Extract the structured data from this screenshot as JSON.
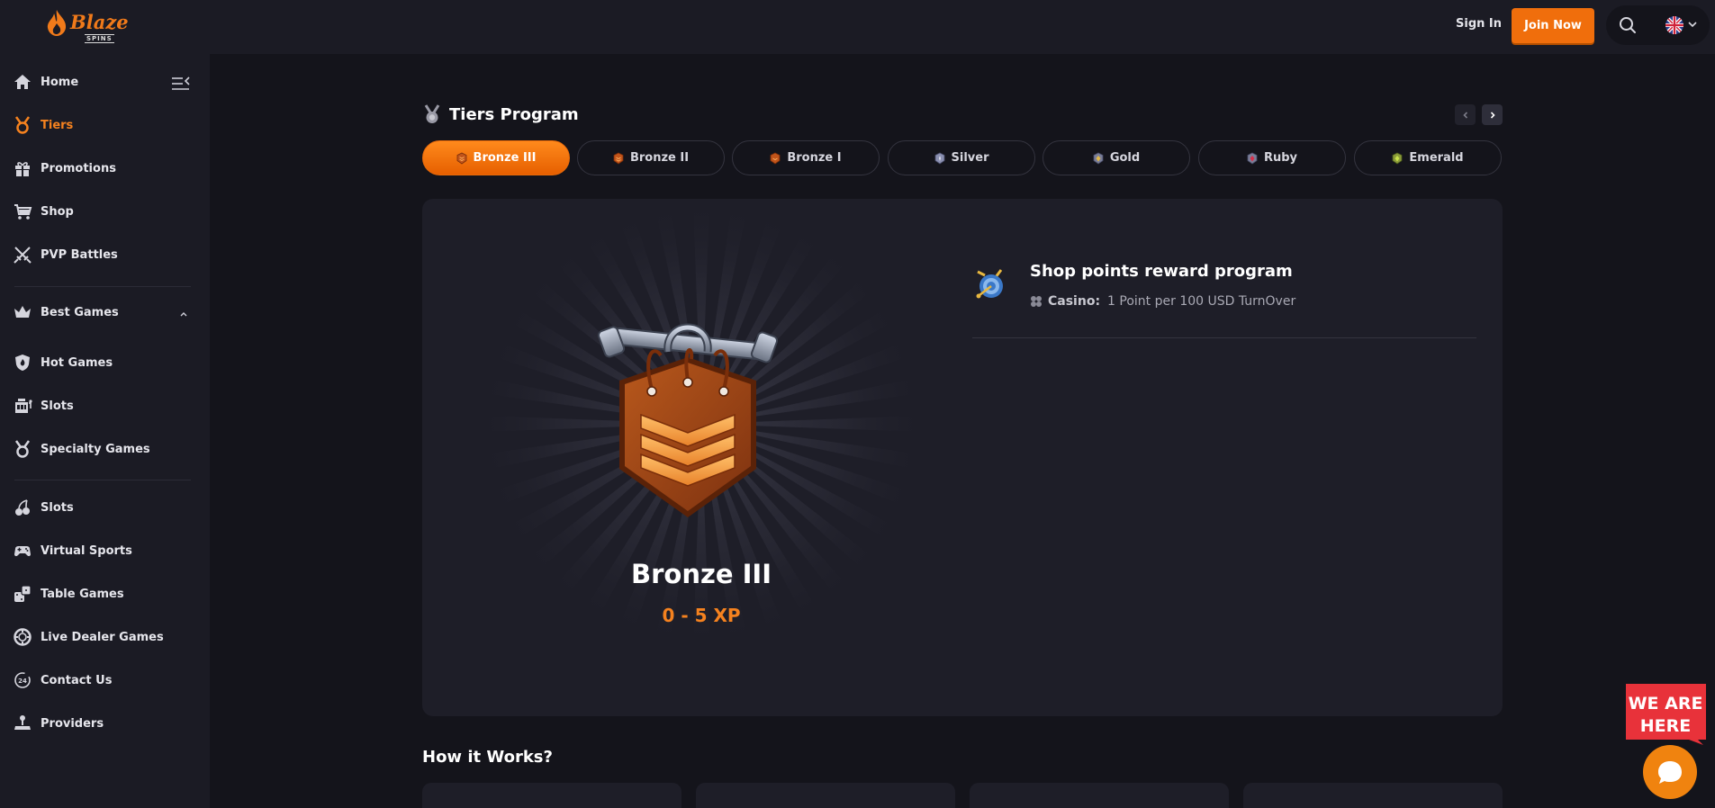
{
  "header": {
    "logo_text": "Blaze",
    "logo_sub": "SPINS",
    "sign_in": "Sign In",
    "join_now": "Join Now",
    "search_icon": "search-icon",
    "language_flag": "uk-flag-icon"
  },
  "sidebar": {
    "items": [
      {
        "label": "Home",
        "icon": "home-icon"
      },
      {
        "label": "Tiers",
        "icon": "medal-icon",
        "active": true
      },
      {
        "label": "Promotions",
        "icon": "gift-icon"
      },
      {
        "label": "Shop",
        "icon": "cart-icon"
      },
      {
        "label": "PVP Battles",
        "icon": "swords-icon"
      },
      {
        "label": "Best Games",
        "icon": "crown-icon"
      },
      {
        "label": "Hot Games",
        "icon": "flame-shield-icon"
      },
      {
        "label": "Slots",
        "icon": "slot-machine-icon"
      },
      {
        "label": "Specialty Games",
        "icon": "medal-icon"
      },
      {
        "label": "Slots",
        "icon": "cherries-icon"
      },
      {
        "label": "Virtual Sports",
        "icon": "gamepad-icon"
      },
      {
        "label": "Table Games",
        "icon": "dice-icon"
      },
      {
        "label": "Live Dealer Games",
        "icon": "chip-icon"
      },
      {
        "label": "Contact Us",
        "icon": "support-24-icon"
      },
      {
        "label": "Providers",
        "icon": "joystick-icon"
      }
    ]
  },
  "tiers": {
    "title": "Tiers Program",
    "tabs": [
      {
        "label": "Bronze III",
        "color": "#c1541a",
        "active": true
      },
      {
        "label": "Bronze II",
        "color": "#c1541a"
      },
      {
        "label": "Bronze I",
        "color": "#c1541a"
      },
      {
        "label": "Silver",
        "color": "#8a8fb0"
      },
      {
        "label": "Gold",
        "color": "#c09a3a"
      },
      {
        "label": "Ruby",
        "color": "#c0304a"
      },
      {
        "label": "Emerald",
        "color": "#9ab83a"
      }
    ],
    "selected": {
      "name": "Bronze III",
      "xp": "0 - 5 XP"
    },
    "reward": {
      "title": "Shop points reward program",
      "label": "Casino:",
      "value": "1 Point per 100 USD TurnOver"
    }
  },
  "how_it_works": {
    "title": "How it Works?"
  },
  "chat": {
    "banner": "WE ARE HERE"
  },
  "colors": {
    "accent": "#f5821f",
    "background": "#14141b",
    "panel": "#1b1b24"
  }
}
